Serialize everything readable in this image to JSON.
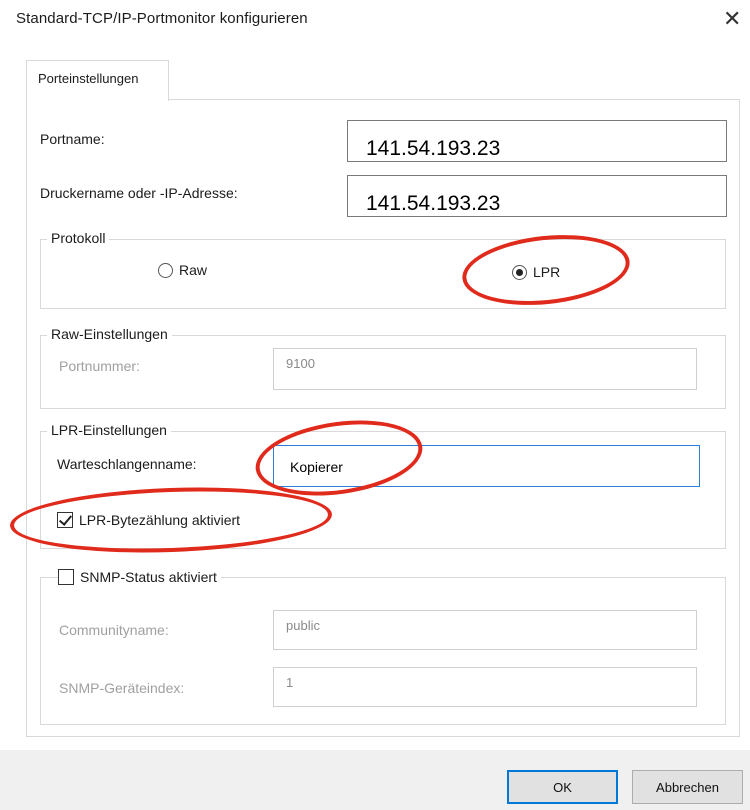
{
  "window": {
    "title": "Standard-TCP/IP-Portmonitor konfigurieren",
    "close_glyph": "✕"
  },
  "tab": {
    "label": "Porteinstellungen"
  },
  "port": {
    "portname_label": "Portname:",
    "portname_value": "141.54.193.23",
    "printer_label": "Druckername oder -IP-Adresse:",
    "printer_value": "141.54.193.23"
  },
  "protocol": {
    "title": "Protokoll",
    "options": [
      {
        "label": "Raw",
        "selected": false
      },
      {
        "label": "LPR",
        "selected": true
      }
    ]
  },
  "raw_settings": {
    "title": "Raw-Einstellungen",
    "port_label": "Portnummer:",
    "port_value": "9100"
  },
  "lpr_settings": {
    "title": "LPR-Einstellungen",
    "queue_label": "Warteschlangenname:",
    "queue_value": "Kopierer",
    "bytecount_label": "LPR-Bytezählung aktiviert",
    "bytecount_checked": true
  },
  "snmp": {
    "status_label": "SNMP-Status aktiviert",
    "status_checked": false,
    "community_label": "Communityname:",
    "community_value": "public",
    "device_label": "SNMP-Geräteindex:",
    "device_value": "1"
  },
  "buttons": {
    "ok": "OK",
    "cancel": "Abbrechen"
  },
  "colors": {
    "annotation": "#e02a1b",
    "focus": "#2d7fd6",
    "primary_border": "#0078d7"
  }
}
